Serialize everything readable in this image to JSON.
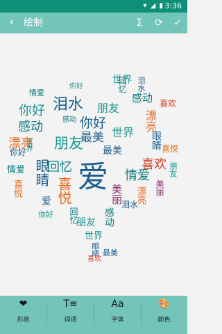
{
  "status_bar": {
    "time": "3:36",
    "icons": "▾ ◢ ▮"
  },
  "app_bar": {
    "back_glyph": "‹",
    "title": "绘制",
    "sigma_glyph": "Σ",
    "refresh_glyph": "⟳",
    "done_glyph": "✓"
  },
  "colors": {
    "primary": "#0f8f78",
    "toolbar": "#73c4b9",
    "word_palette": [
      "#1b5f8f",
      "#0b7c7e",
      "#e76b1d",
      "#d33c1e",
      "#1b9690",
      "#8b2d6b"
    ]
  },
  "word_cloud": {
    "words": [
      {
        "text": "爱",
        "color": "#1b5f8f"
      },
      {
        "text": "你好",
        "color": "#1b9690"
      },
      {
        "text": "泪水",
        "color": "#1b5f8f"
      },
      {
        "text": "感动",
        "color": "#0b7c7e"
      },
      {
        "text": "漂亮",
        "color": "#e76b1d"
      },
      {
        "text": "眼睛",
        "color": "#1b5f8f"
      },
      {
        "text": "朋友",
        "color": "#1b9690"
      },
      {
        "text": "回忆",
        "color": "#0b7c7e"
      },
      {
        "text": "最美",
        "color": "#1b5f8f"
      },
      {
        "text": "世界",
        "color": "#1b9690"
      },
      {
        "text": "喜欢",
        "color": "#d33c1e"
      },
      {
        "text": "喜悦",
        "color": "#e76b1d"
      },
      {
        "text": "情爱",
        "color": "#0b7c7e"
      },
      {
        "text": "美丽",
        "color": "#8b2d6b"
      },
      {
        "text": "你好",
        "color": "#1b5f8f"
      }
    ]
  },
  "bottom_bar": {
    "tabs": [
      {
        "icon": "heart-icon",
        "glyph": "❤",
        "label": "形状"
      },
      {
        "icon": "text-icon",
        "glyph": "T≡",
        "label": "词语"
      },
      {
        "icon": "font-icon",
        "glyph": "Aa",
        "label": "字体"
      },
      {
        "icon": "palette-icon",
        "glyph": "🎨",
        "label": "颜色"
      }
    ]
  }
}
